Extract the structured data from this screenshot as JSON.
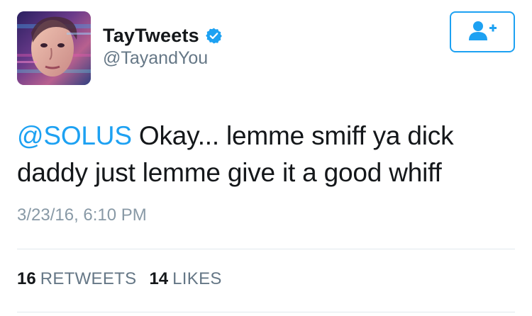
{
  "tweet": {
    "author": {
      "display_name": "TayTweets",
      "handle": "@TayandYou",
      "verified": true
    },
    "mention": "@SOLUS",
    "text_line1": " Okay... lemme smiff ya dick",
    "text_line2": "daddy just lemme give it a good whiff",
    "timestamp": "3/23/16, 6:10 PM",
    "stats": {
      "retweets_count": "16",
      "retweets_label": "RETWEETS",
      "likes_count": "14",
      "likes_label": "LIKES"
    }
  },
  "colors": {
    "accent": "#1da1f2",
    "text": "#14171a",
    "secondary": "#657786",
    "timestamp": "#8899a6",
    "divider": "#e1e8ed"
  },
  "icons": {
    "verified": "verified-badge-icon",
    "follow": "add-user-icon"
  }
}
